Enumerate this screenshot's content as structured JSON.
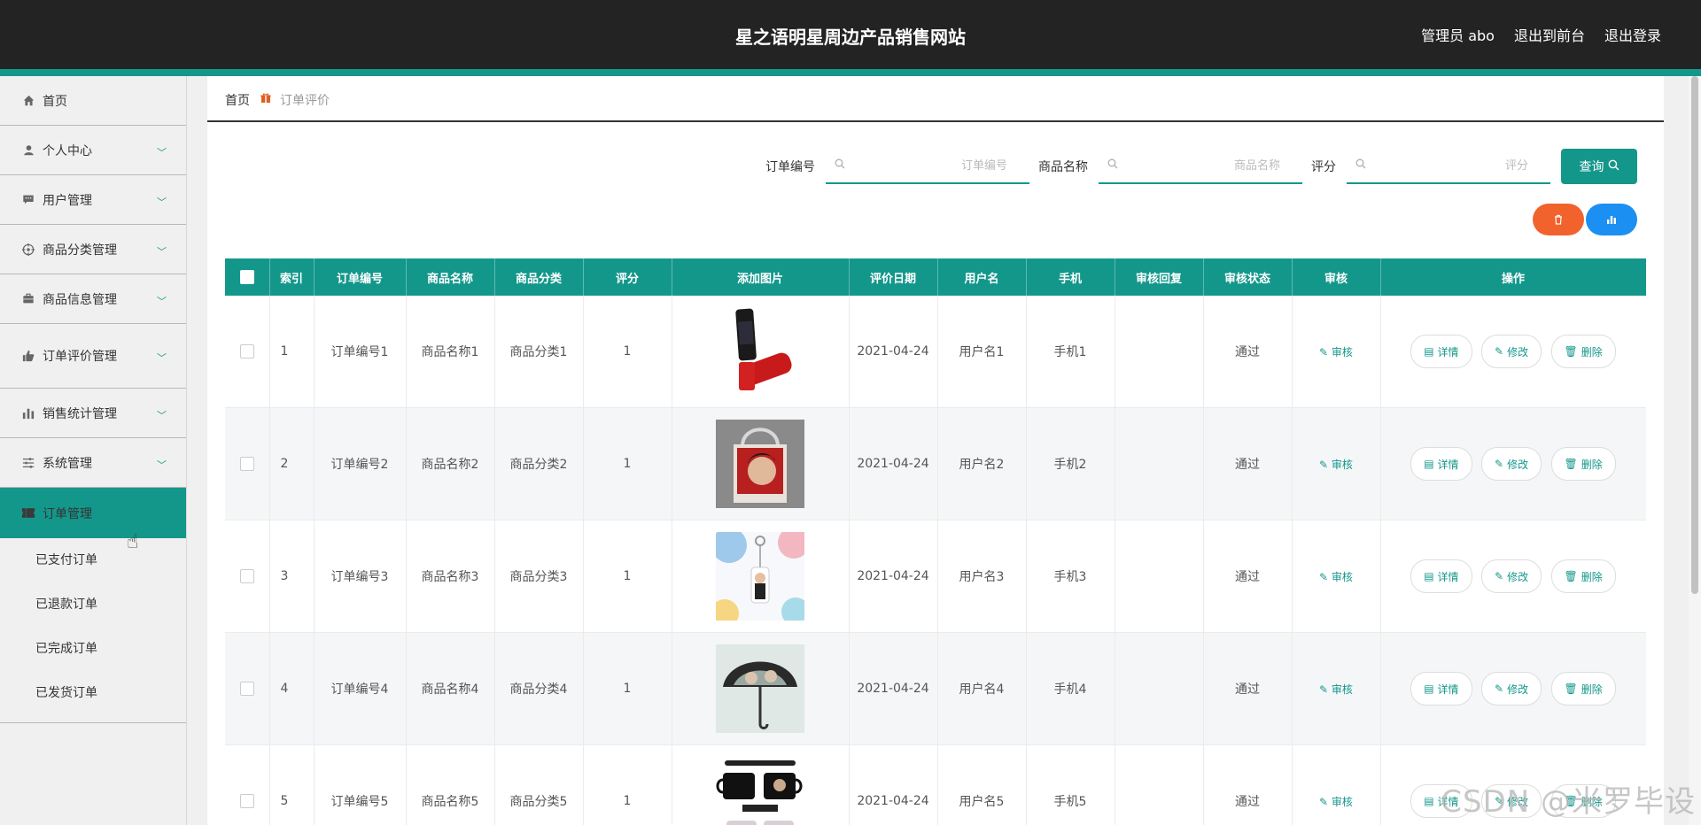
{
  "header": {
    "title": "星之语明星周边产品销售网站",
    "user_label": "管理员 abo",
    "frontend_label": "退出到前台",
    "logout_label": "退出登录"
  },
  "sidebar": {
    "items": [
      {
        "label": "首页",
        "icon": "home-icon"
      },
      {
        "label": "个人中心",
        "icon": "user-icon"
      },
      {
        "label": "用户管理",
        "icon": "chat-icon"
      },
      {
        "label": "商品分类管理",
        "icon": "target-icon"
      },
      {
        "label": "商品信息管理",
        "icon": "briefcase-icon"
      },
      {
        "label": "订单评价管理",
        "icon": "thumb-up-icon"
      },
      {
        "label": "销售统计管理",
        "icon": "bar-chart-icon"
      },
      {
        "label": "系统管理",
        "icon": "sliders-icon"
      },
      {
        "label": "订单管理",
        "icon": "ticket-icon"
      }
    ],
    "sub_items": [
      "已支付订单",
      "已退款订单",
      "已完成订单",
      "已发货订单"
    ]
  },
  "breadcrumb": {
    "home": "首页",
    "current": "订单评价"
  },
  "search": {
    "order_no_label": "订单编号",
    "order_no_placeholder": "订单编号",
    "product_name_label": "商品名称",
    "product_name_placeholder": "商品名称",
    "rating_label": "评分",
    "rating_placeholder": "评分",
    "query_label": "查询"
  },
  "table": {
    "headers": [
      "索引",
      "订单编号",
      "商品名称",
      "商品分类",
      "评分",
      "添加图片",
      "评价日期",
      "用户名",
      "手机",
      "审核回复",
      "审核状态",
      "审核",
      "操作"
    ],
    "audit_link": "审核",
    "op_detail": "详情",
    "op_edit": "修改",
    "op_delete": "删除",
    "rows": [
      {
        "index": "1",
        "order_no": "订单编号1",
        "product": "商品名称1",
        "category": "商品分类1",
        "rating": "1",
        "image": "red-thermos-bottle",
        "date": "2021-04-24",
        "user": "用户名1",
        "phone": "手机1",
        "reply": "",
        "status": "通过"
      },
      {
        "index": "2",
        "order_no": "订单编号2",
        "product": "商品名称2",
        "category": "商品分类2",
        "rating": "1",
        "image": "tote-bag-photo",
        "date": "2021-04-24",
        "user": "用户名2",
        "phone": "手机2",
        "reply": "",
        "status": "通过"
      },
      {
        "index": "3",
        "order_no": "订单编号3",
        "product": "商品名称3",
        "category": "商品分类3",
        "rating": "1",
        "image": "keychain-photo",
        "date": "2021-04-24",
        "user": "用户名3",
        "phone": "手机3",
        "reply": "",
        "status": "通过"
      },
      {
        "index": "4",
        "order_no": "订单编号4",
        "product": "商品名称4",
        "category": "商品分类4",
        "rating": "1",
        "image": "umbrella-photo",
        "date": "2021-04-24",
        "user": "用户名4",
        "phone": "手机4",
        "reply": "",
        "status": "通过"
      },
      {
        "index": "5",
        "order_no": "订单编号5",
        "product": "商品名称5",
        "category": "商品分类5",
        "rating": "1",
        "image": "color-changing-mug-photo",
        "date": "2021-04-24",
        "user": "用户名5",
        "phone": "手机5",
        "reply": "",
        "status": "通过"
      }
    ]
  },
  "watermark": "CSDN @米罗毕设",
  "colors": {
    "accent": "#14978b",
    "danger": "#f2622c",
    "info": "#1b8ff2",
    "header_bg": "#232323"
  }
}
